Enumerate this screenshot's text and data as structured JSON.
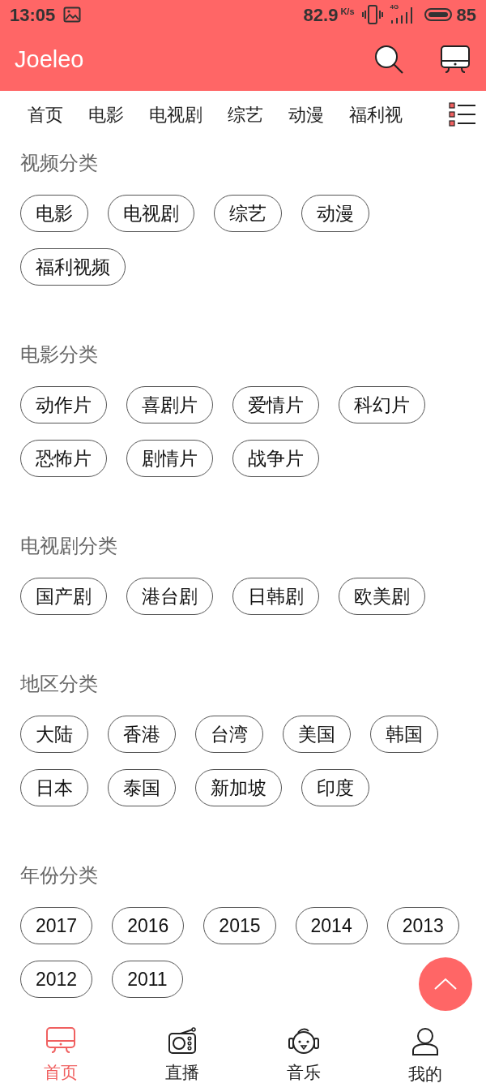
{
  "status_bar": {
    "time": "13:05",
    "speed": "82.9",
    "speed_unit": "K/s",
    "network": "4G",
    "battery": "85"
  },
  "app_bar": {
    "title": "Joeleo"
  },
  "category_tabs": [
    "首页",
    "电影",
    "电视剧",
    "综艺",
    "动漫",
    "福利视"
  ],
  "sections": [
    {
      "title": "视频分类",
      "chips": [
        "电影",
        "电视剧",
        "综艺",
        "动漫",
        "福利视频"
      ]
    },
    {
      "title": "电影分类",
      "chips": [
        "动作片",
        "喜剧片",
        "爱情片",
        "科幻片",
        "恐怖片",
        "剧情片",
        "战争片"
      ]
    },
    {
      "title": "电视剧分类",
      "chips": [
        "国产剧",
        "港台剧",
        "日韩剧",
        "欧美剧"
      ]
    },
    {
      "title": "地区分类",
      "chips": [
        "大陆",
        "香港",
        "台湾",
        "美国",
        "韩国",
        "日本",
        "泰国",
        "新加坡",
        "印度"
      ]
    },
    {
      "title": "年份分类",
      "chips": [
        "2017",
        "2016",
        "2015",
        "2014",
        "2013",
        "2012",
        "2011"
      ]
    }
  ],
  "bottom_nav": [
    {
      "label": "首页",
      "kind": "tv",
      "selected": true
    },
    {
      "label": "直播",
      "kind": "radio",
      "selected": false
    },
    {
      "label": "音乐",
      "kind": "music",
      "selected": false
    },
    {
      "label": "我的",
      "kind": "user",
      "selected": false
    }
  ]
}
